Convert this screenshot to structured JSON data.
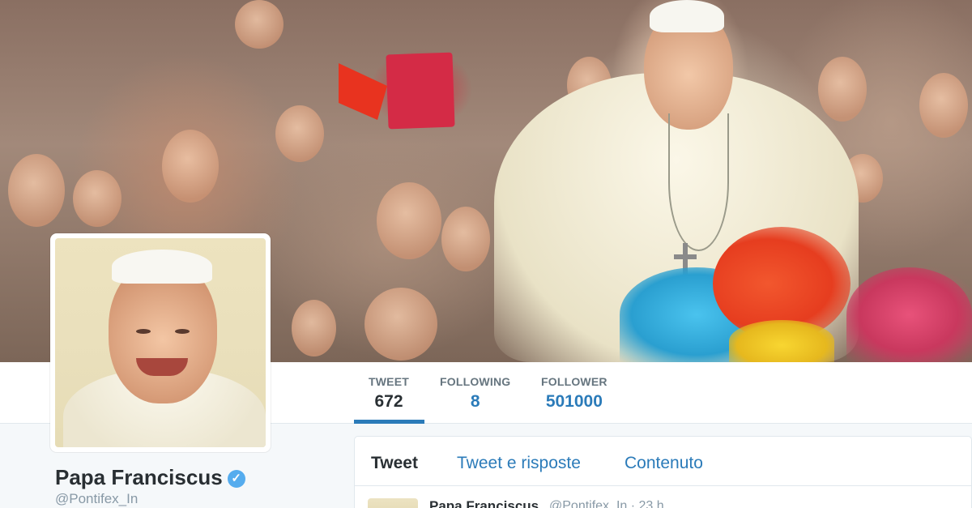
{
  "profile": {
    "name": "Papa Franciscus",
    "verified_glyph": "✓",
    "handle": "@Pontifex_In"
  },
  "stats": [
    {
      "label": "TWEET",
      "value": "672"
    },
    {
      "label": "FOLLOWING",
      "value": "8"
    },
    {
      "label": "FOLLOWER",
      "value": "501000"
    }
  ],
  "tabs": [
    {
      "label": "Tweet"
    },
    {
      "label": "Tweet e risposte"
    },
    {
      "label": "Contenuto"
    }
  ],
  "tweet_preview": {
    "name": "Papa Franciscus",
    "meta": "@Pontifex_In · 23 h"
  },
  "colors": {
    "accent": "#2b7bb9",
    "verified": "#55acee",
    "text": "#292f33",
    "muted": "#8899a6"
  },
  "icons": [
    "verified-badge-icon"
  ]
}
